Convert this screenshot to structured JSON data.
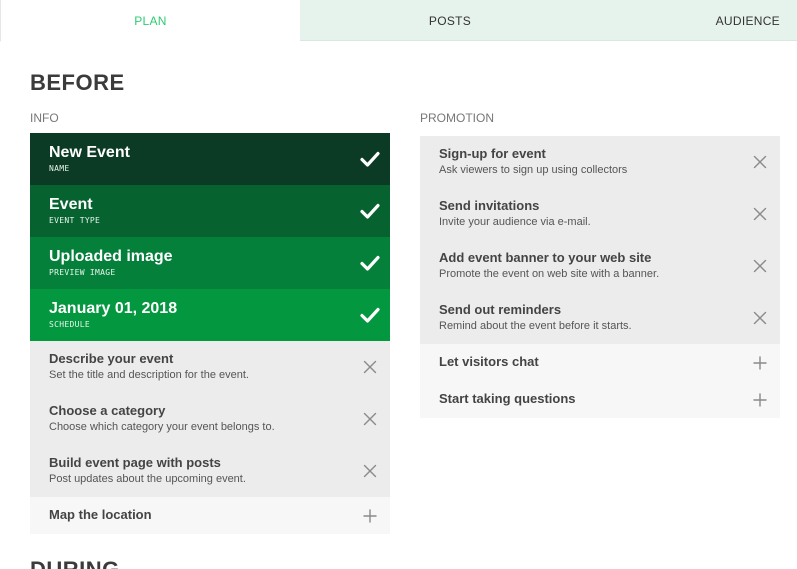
{
  "tabs": [
    {
      "label": "PLAN",
      "active": true
    },
    {
      "label": "POSTS",
      "active": false
    },
    {
      "label": "AUDIENCE",
      "active": false
    }
  ],
  "section_before": "BEFORE",
  "section_during": "DURING",
  "info": {
    "label": "INFO",
    "done": [
      {
        "title": "New Event",
        "sub": "NAME",
        "icon": "check-icon"
      },
      {
        "title": "Event",
        "sub": "EVENT TYPE",
        "icon": "check-icon"
      },
      {
        "title": "Uploaded image",
        "sub": "PREVIEW IMAGE",
        "icon": "check-icon"
      },
      {
        "title": "January 01, 2018",
        "sub": "SCHEDULE",
        "icon": "check-icon"
      }
    ],
    "todo": [
      {
        "title": "Describe your event",
        "sub": "Set the title and description for the event.",
        "icon": "close-icon"
      },
      {
        "title": "Choose a category",
        "sub": "Choose which category your event belongs to.",
        "icon": "close-icon"
      },
      {
        "title": "Build event page with posts",
        "sub": "Post updates about the upcoming event.",
        "icon": "close-icon"
      }
    ],
    "add": [
      {
        "title": "Map the location",
        "icon": "plus-icon"
      }
    ]
  },
  "promotion": {
    "label": "PROMOTION",
    "todo": [
      {
        "title": "Sign-up for event",
        "sub": "Ask viewers to sign up using collectors",
        "icon": "close-icon"
      },
      {
        "title": "Send invitations",
        "sub": "Invite your audience via e-mail.",
        "icon": "close-icon"
      },
      {
        "title": "Add event banner to your web site",
        "sub": "Promote the event on web site with a banner.",
        "icon": "close-icon"
      },
      {
        "title": "Send out reminders",
        "sub": "Remind about the event before it starts.",
        "icon": "close-icon"
      }
    ],
    "add": [
      {
        "title": "Let visitors chat",
        "icon": "plus-icon"
      },
      {
        "title": "Start taking questions",
        "icon": "plus-icon"
      }
    ]
  },
  "colors": {
    "accent": "#2ecc71",
    "done_1": "#0b3b24",
    "done_2": "#06632f",
    "done_3": "#04803b",
    "done_4": "#03973f",
    "todo_bg": "#ececec",
    "add_bg": "#f7f7f7"
  }
}
